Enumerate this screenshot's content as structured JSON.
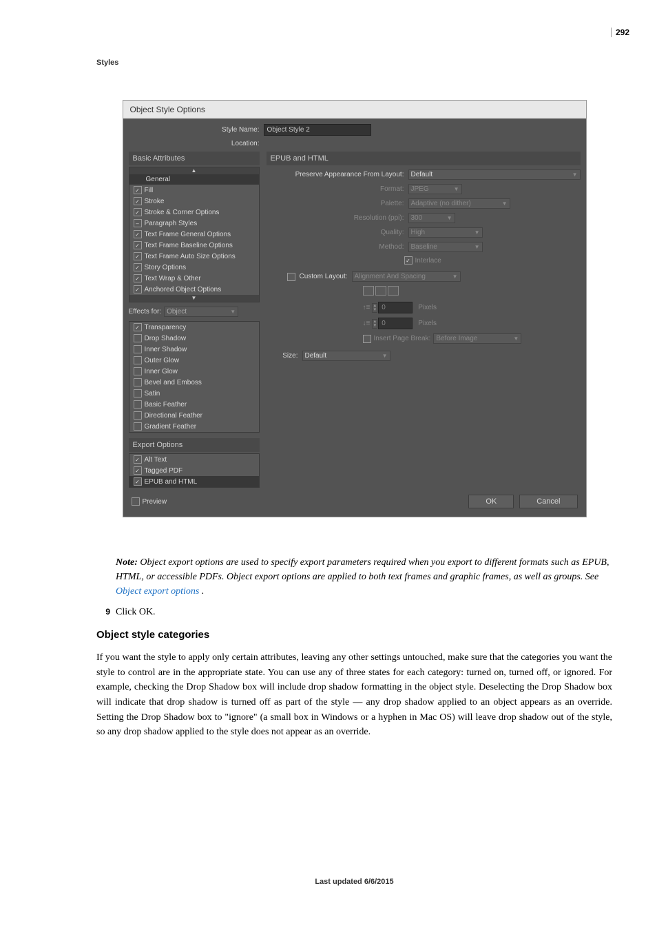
{
  "page_number": "292",
  "section_header": "Styles",
  "dialog": {
    "title": "Object Style Options",
    "style_name_label": "Style Name:",
    "style_name_value": "Object Style 2",
    "location_label": "Location:",
    "basic_attributes_header": "Basic Attributes",
    "basic_items": [
      {
        "label": "General",
        "state": "none",
        "selected": true
      },
      {
        "label": "Fill",
        "state": "on"
      },
      {
        "label": "Stroke",
        "state": "on"
      },
      {
        "label": "Stroke & Corner Options",
        "state": "on"
      },
      {
        "label": "Paragraph Styles",
        "state": "mixed"
      },
      {
        "label": "Text Frame General Options",
        "state": "on"
      },
      {
        "label": "Text Frame Baseline Options",
        "state": "on"
      },
      {
        "label": "Text Frame Auto Size Options",
        "state": "on"
      },
      {
        "label": "Story Options",
        "state": "on"
      },
      {
        "label": "Text Wrap & Other",
        "state": "on"
      },
      {
        "label": "Anchored Object Options",
        "state": "on"
      }
    ],
    "effects_for_label": "Effects for:",
    "effects_for_value": "Object",
    "effects_items": [
      {
        "label": "Transparency",
        "state": "on"
      },
      {
        "label": "Drop Shadow",
        "state": "off"
      },
      {
        "label": "Inner Shadow",
        "state": "off"
      },
      {
        "label": "Outer Glow",
        "state": "off"
      },
      {
        "label": "Inner Glow",
        "state": "off"
      },
      {
        "label": "Bevel and Emboss",
        "state": "off"
      },
      {
        "label": "Satin",
        "state": "off"
      },
      {
        "label": "Basic Feather",
        "state": "off"
      },
      {
        "label": "Directional Feather",
        "state": "off"
      },
      {
        "label": "Gradient Feather",
        "state": "off"
      }
    ],
    "export_options_header": "Export Options",
    "export_items": [
      {
        "label": "Alt Text",
        "state": "on"
      },
      {
        "label": "Tagged PDF",
        "state": "on"
      },
      {
        "label": "EPUB and HTML",
        "state": "on",
        "selected": true
      }
    ],
    "panel_title": "EPUB and HTML",
    "preserve_label": "Preserve Appearance From Layout:",
    "preserve_value": "Default",
    "format_label": "Format:",
    "format_value": "JPEG",
    "palette_label": "Palette:",
    "palette_value": "Adaptive (no dither)",
    "resolution_label": "Resolution (ppi):",
    "resolution_value": "300",
    "quality_label": "Quality:",
    "quality_value": "High",
    "method_label": "Method:",
    "method_value": "Baseline",
    "interlace_label": "Interlace",
    "custom_layout_label": "Custom Layout:",
    "custom_layout_value": "Alignment And Spacing",
    "spacing_before_value": "0",
    "spacing_after_value": "0",
    "pixels_label": "Pixels",
    "insert_break_label": "Insert Page Break:",
    "insert_break_value": "Before Image",
    "size_label": "Size:",
    "size_value": "Default",
    "preview_label": "Preview",
    "ok_label": "OK",
    "cancel_label": "Cancel"
  },
  "note": {
    "prefix": "Note:",
    "text1": " Object export options are used to specify export parameters required when you export to different formats such as EPUB, HTML, or accessible PDFs. Object export options are applied to both text frames and graphic frames, as well as groups. See ",
    "link": "Object export options",
    "text2": " ."
  },
  "step9_num": "9",
  "step9_text": "Click OK.",
  "h2": "Object style categories",
  "body": "If you want the style to apply only certain attributes, leaving any other settings untouched, make sure that the categories you want the style to control are in the appropriate state. You can use any of three states for each category: turned on, turned off, or ignored. For example, checking the Drop Shadow box will include drop shadow formatting in the object style. Deselecting the Drop Shadow box will indicate that drop shadow is turned off as part of the style — any drop shadow applied to an object appears as an override. Setting the Drop Shadow box to \"ignore\" (a small box in Windows or a hyphen in Mac OS) will leave drop shadow out of the style, so any drop shadow applied to the style does not appear as an override.",
  "updated": "Last updated 6/6/2015"
}
